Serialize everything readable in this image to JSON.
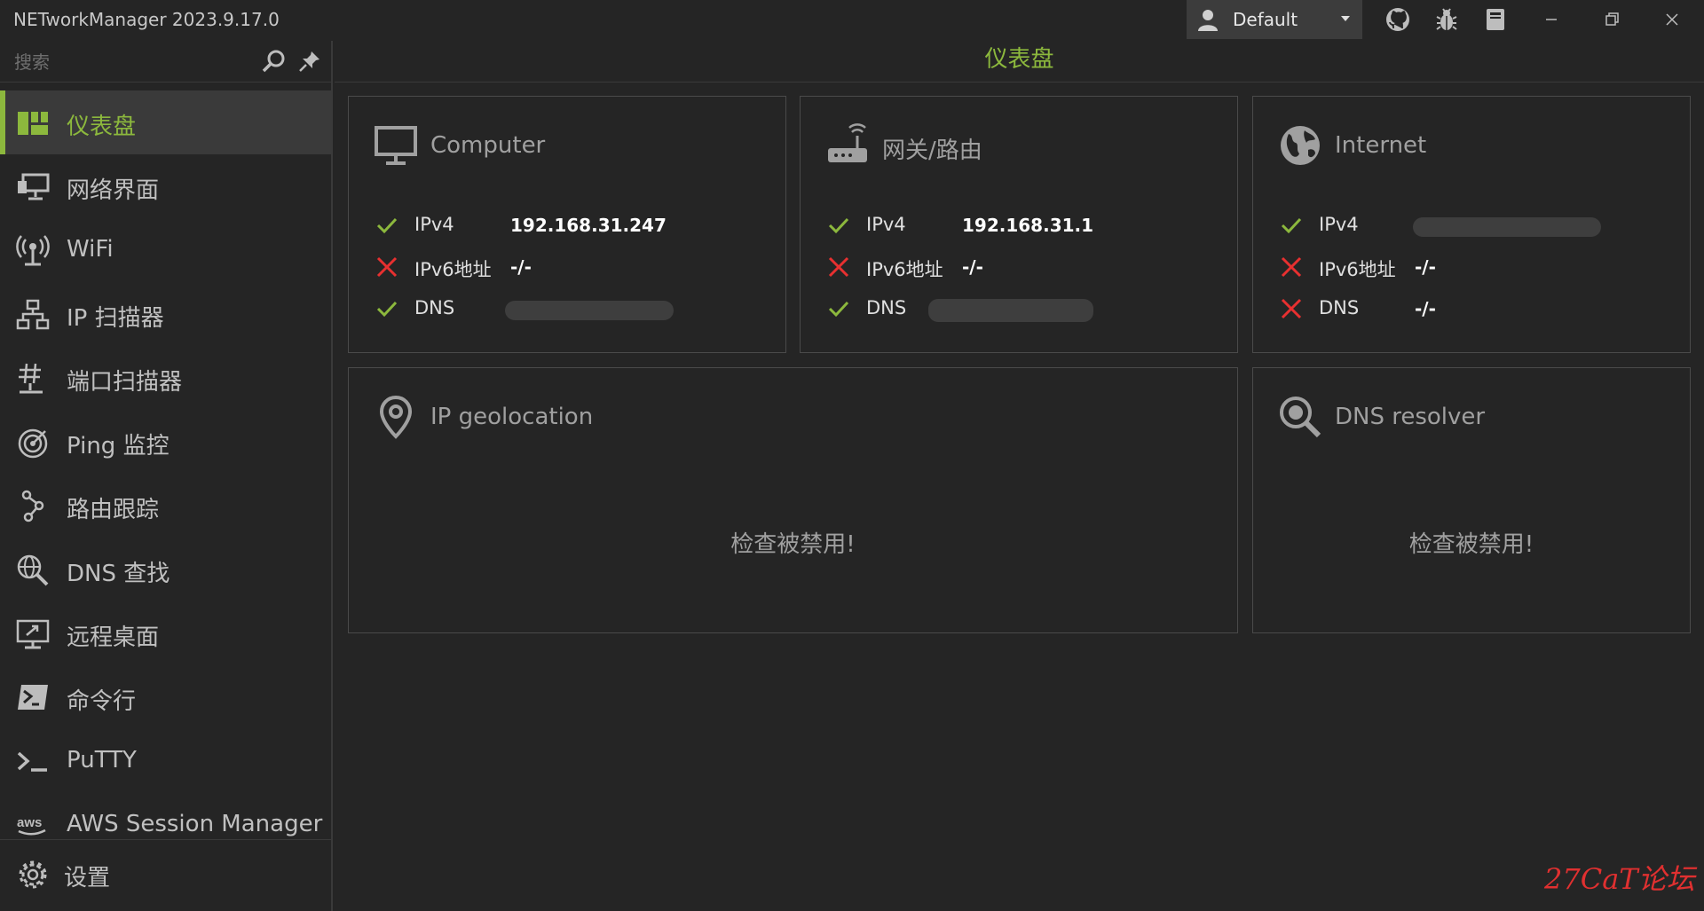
{
  "app": {
    "title": "NETworkManager 2023.9.17.0"
  },
  "profile": {
    "name": "Default"
  },
  "titlebar_icons": [
    "github-icon",
    "bug-icon",
    "book-icon"
  ],
  "sidebar": {
    "search_placeholder": "搜索",
    "items": [
      {
        "label": "仪表盘",
        "icon": "dashboard-icon",
        "active": true
      },
      {
        "label": "网络界面",
        "icon": "network-interface-icon"
      },
      {
        "label": "WiFi",
        "icon": "wifi-icon"
      },
      {
        "label": "IP 扫描器",
        "icon": "ip-scanner-icon"
      },
      {
        "label": "端口扫描器",
        "icon": "port-scanner-icon"
      },
      {
        "label": "Ping 监控",
        "icon": "ping-monitor-icon"
      },
      {
        "label": "路由跟踪",
        "icon": "traceroute-icon"
      },
      {
        "label": "DNS 查找",
        "icon": "dns-lookup-icon"
      },
      {
        "label": "远程桌面",
        "icon": "remote-desktop-icon"
      },
      {
        "label": "命令行",
        "icon": "powershell-icon"
      },
      {
        "label": "PuTTY",
        "icon": "terminal-icon"
      },
      {
        "label": "AWS Session Manager",
        "icon": "aws-icon"
      }
    ],
    "settings_label": "设置"
  },
  "main": {
    "title": "仪表盘",
    "computer": {
      "title": "Computer",
      "rows": [
        {
          "key": "IPv4",
          "value": "192.168.31.247",
          "ok": true
        },
        {
          "key": "IPv6地址",
          "value": "-/-",
          "ok": false
        },
        {
          "key": "DNS",
          "value": "",
          "ok": true
        }
      ]
    },
    "gateway": {
      "title": "网关/路由",
      "rows": [
        {
          "key": "IPv4",
          "value": "192.168.31.1",
          "ok": true
        },
        {
          "key": "IPv6地址",
          "value": "-/-",
          "ok": false
        },
        {
          "key": "DNS",
          "value": "",
          "ok": true
        }
      ]
    },
    "internet": {
      "title": "Internet",
      "rows": [
        {
          "key": "IPv4",
          "value": "",
          "ok": true
        },
        {
          "key": "IPv6地址",
          "value": "-/-",
          "ok": false
        },
        {
          "key": "DNS",
          "value": "-/-",
          "ok": false
        }
      ]
    },
    "geolocation": {
      "title": "IP geolocation",
      "message": "检查被禁用!"
    },
    "dns_resolver": {
      "title": "DNS resolver",
      "message": "检查被禁用!"
    }
  },
  "watermark": "27CaT论坛",
  "colors": {
    "accent": "#8cb83d",
    "error": "#e83030",
    "background": "#252525"
  }
}
